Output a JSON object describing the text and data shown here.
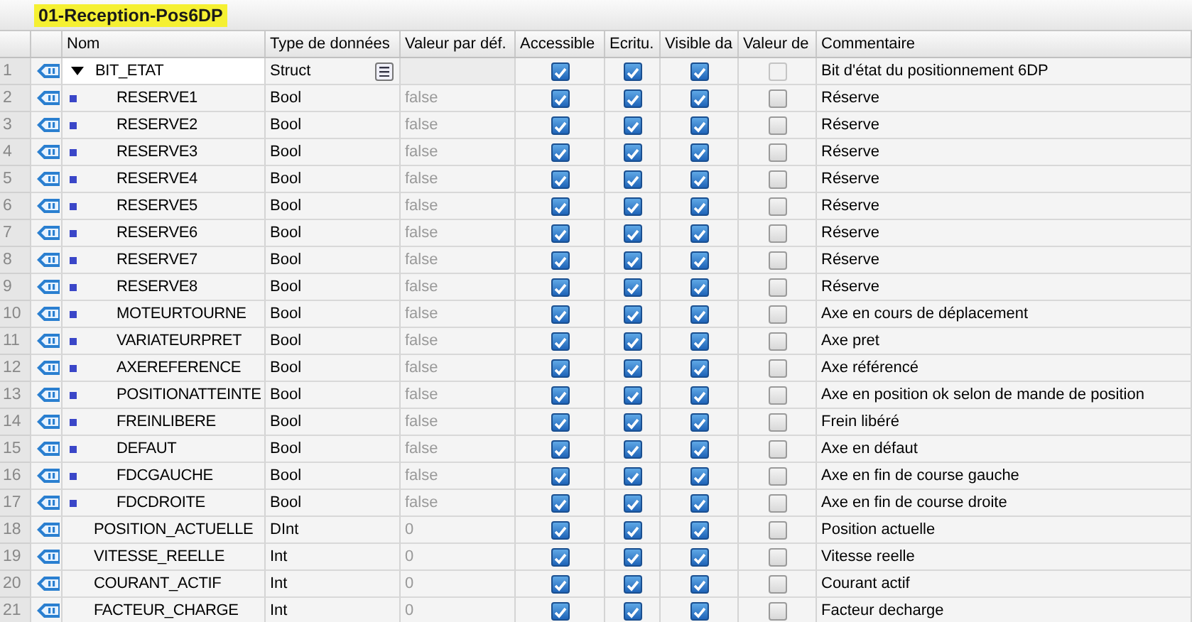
{
  "title": "01-Reception-Pos6DP",
  "columns": [
    "Nom",
    "Type de données",
    "Valeur par déf.",
    "Accessible",
    "Ecritu.",
    "Visible da",
    "Valeur de",
    "Commentaire"
  ],
  "rows": [
    {
      "number": "1",
      "name": "BIT_ETAT",
      "type": "Struct",
      "expanded": true,
      "accessible": true,
      "writable": true,
      "visible": true,
      "setpoint": false,
      "comment": "Bit d'état du positionnement 6DP",
      "children": [
        {
          "number": "2",
          "name": "RESERVE1",
          "type": "Bool",
          "default": "false",
          "accessible": true,
          "writable": true,
          "visible": true,
          "setpoint": false,
          "comment": "Réserve"
        },
        {
          "number": "3",
          "name": "RESERVE2",
          "type": "Bool",
          "default": "false",
          "accessible": true,
          "writable": true,
          "visible": true,
          "setpoint": false,
          "comment": "Réserve"
        },
        {
          "number": "4",
          "name": "RESERVE3",
          "type": "Bool",
          "default": "false",
          "accessible": true,
          "writable": true,
          "visible": true,
          "setpoint": false,
          "comment": "Réserve"
        },
        {
          "number": "5",
          "name": "RESERVE4",
          "type": "Bool",
          "default": "false",
          "accessible": true,
          "writable": true,
          "visible": true,
          "setpoint": false,
          "comment": "Réserve"
        },
        {
          "number": "6",
          "name": "RESERVE5",
          "type": "Bool",
          "default": "false",
          "accessible": true,
          "writable": true,
          "visible": true,
          "setpoint": false,
          "comment": "Réserve"
        },
        {
          "number": "7",
          "name": "RESERVE6",
          "type": "Bool",
          "default": "false",
          "accessible": true,
          "writable": true,
          "visible": true,
          "setpoint": false,
          "comment": "Réserve"
        },
        {
          "number": "8",
          "name": "RESERVE7",
          "type": "Bool",
          "default": "false",
          "accessible": true,
          "writable": true,
          "visible": true,
          "setpoint": false,
          "comment": "Réserve"
        },
        {
          "number": "9",
          "name": "RESERVE8",
          "type": "Bool",
          "default": "false",
          "accessible": true,
          "writable": true,
          "visible": true,
          "setpoint": false,
          "comment": "Réserve"
        },
        {
          "number": "10",
          "name": "MOTEURTOURNE",
          "type": "Bool",
          "default": "false",
          "accessible": true,
          "writable": true,
          "visible": true,
          "setpoint": false,
          "comment": "Axe en cours de déplacement"
        },
        {
          "number": "11",
          "name": "VARIATEURPRET",
          "type": "Bool",
          "default": "false",
          "accessible": true,
          "writable": true,
          "visible": true,
          "setpoint": false,
          "comment": "Axe pret"
        },
        {
          "number": "12",
          "name": "AXEREFERENCE",
          "type": "Bool",
          "default": "false",
          "accessible": true,
          "writable": true,
          "visible": true,
          "setpoint": false,
          "comment": "Axe référencé"
        },
        {
          "number": "13",
          "name": "POSITIONATTEINTE",
          "type": "Bool",
          "default": "false",
          "accessible": true,
          "writable": true,
          "visible": true,
          "setpoint": false,
          "comment": "Axe en position ok selon de mande de position"
        },
        {
          "number": "14",
          "name": "FREINLIBERE",
          "type": "Bool",
          "default": "false",
          "accessible": true,
          "writable": true,
          "visible": true,
          "setpoint": false,
          "comment": "Frein libéré"
        },
        {
          "number": "15",
          "name": "DEFAUT",
          "type": "Bool",
          "default": "false",
          "accessible": true,
          "writable": true,
          "visible": true,
          "setpoint": false,
          "comment": "Axe en défaut"
        },
        {
          "number": "16",
          "name": "FDCGAUCHE",
          "type": "Bool",
          "default": "false",
          "accessible": true,
          "writable": true,
          "visible": true,
          "setpoint": false,
          "comment": "Axe en fin de course gauche"
        },
        {
          "number": "17",
          "name": "FDCDROITE",
          "type": "Bool",
          "default": "false",
          "accessible": true,
          "writable": true,
          "visible": true,
          "setpoint": false,
          "comment": "Axe en fin de course droite"
        }
      ]
    },
    {
      "number": "18",
      "name": "POSITION_ACTUELLE",
      "type": "DInt",
      "default": "0",
      "accessible": true,
      "writable": true,
      "visible": true,
      "setpoint": false,
      "comment": "Position actuelle"
    },
    {
      "number": "19",
      "name": "VITESSE_REELLE",
      "type": "Int",
      "default": "0",
      "accessible": true,
      "writable": true,
      "visible": true,
      "setpoint": false,
      "comment": "Vitesse reelle"
    },
    {
      "number": "20",
      "name": "COURANT_ACTIF",
      "type": "Int",
      "default": "0",
      "accessible": true,
      "writable": true,
      "visible": true,
      "setpoint": false,
      "comment": "Courant actif"
    },
    {
      "number": "21",
      "name": "FACTEUR_CHARGE",
      "type": "Int",
      "default": "0",
      "accessible": true,
      "writable": true,
      "visible": true,
      "setpoint": false,
      "comment": "Facteur decharge"
    }
  ]
}
